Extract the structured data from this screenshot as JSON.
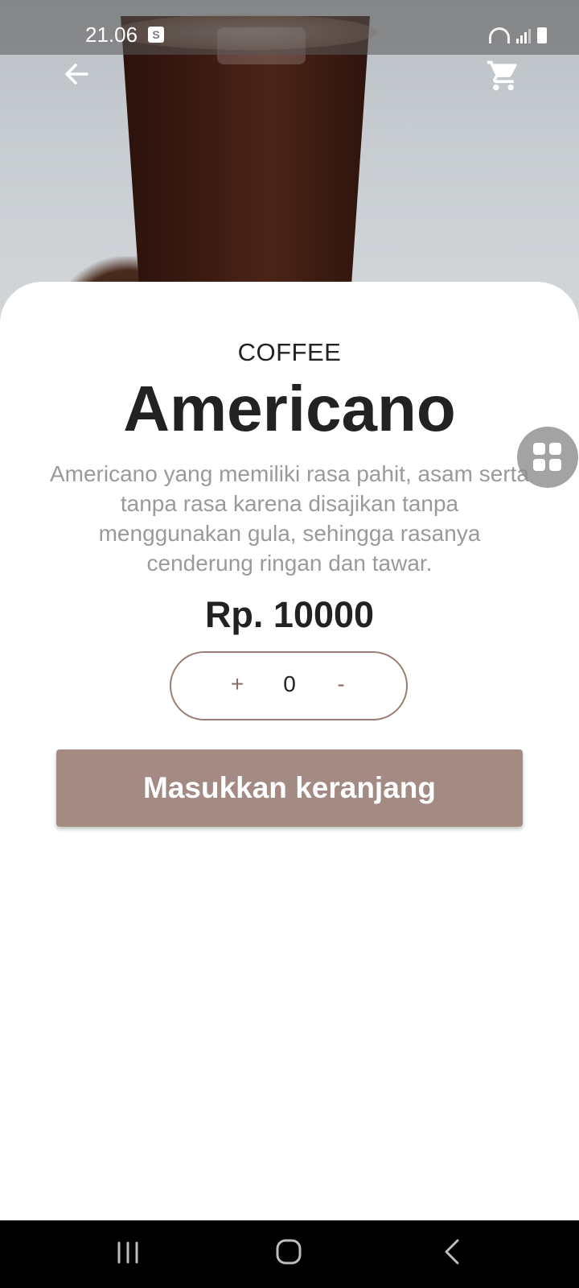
{
  "status_bar": {
    "time": "21.06",
    "shop_icon": "shopping-bag-icon",
    "shop_glyph": "S",
    "icons": [
      "wifi-icon",
      "signal-icon",
      "battery-icon"
    ]
  },
  "header": {
    "back_icon": "arrow-left-icon",
    "cart_icon": "shopping-cart-icon"
  },
  "product": {
    "category": "COFFEE",
    "name": "Americano",
    "description": "Americano yang memiliki rasa pahit, asam serta tanpa rasa karena disajikan tanpa menggunakan gula, sehingga rasanya cenderung ringan dan tawar.",
    "price": "Rp. 10000"
  },
  "quantity": {
    "plus_label": "+",
    "value": "0",
    "minus_label": "-"
  },
  "add_to_cart": {
    "label": "Masukkan keranjang"
  },
  "floating_button": {
    "icon": "apps-grid-icon"
  },
  "nav_bar": {
    "recents_icon": "recents-icon",
    "home_icon": "home-icon",
    "back_icon": "back-chevron-icon"
  },
  "colors": {
    "accent": "#a38a82",
    "stepper_border": "#9a7d74",
    "text_dark": "#222222",
    "text_muted": "#9a9a9a"
  }
}
